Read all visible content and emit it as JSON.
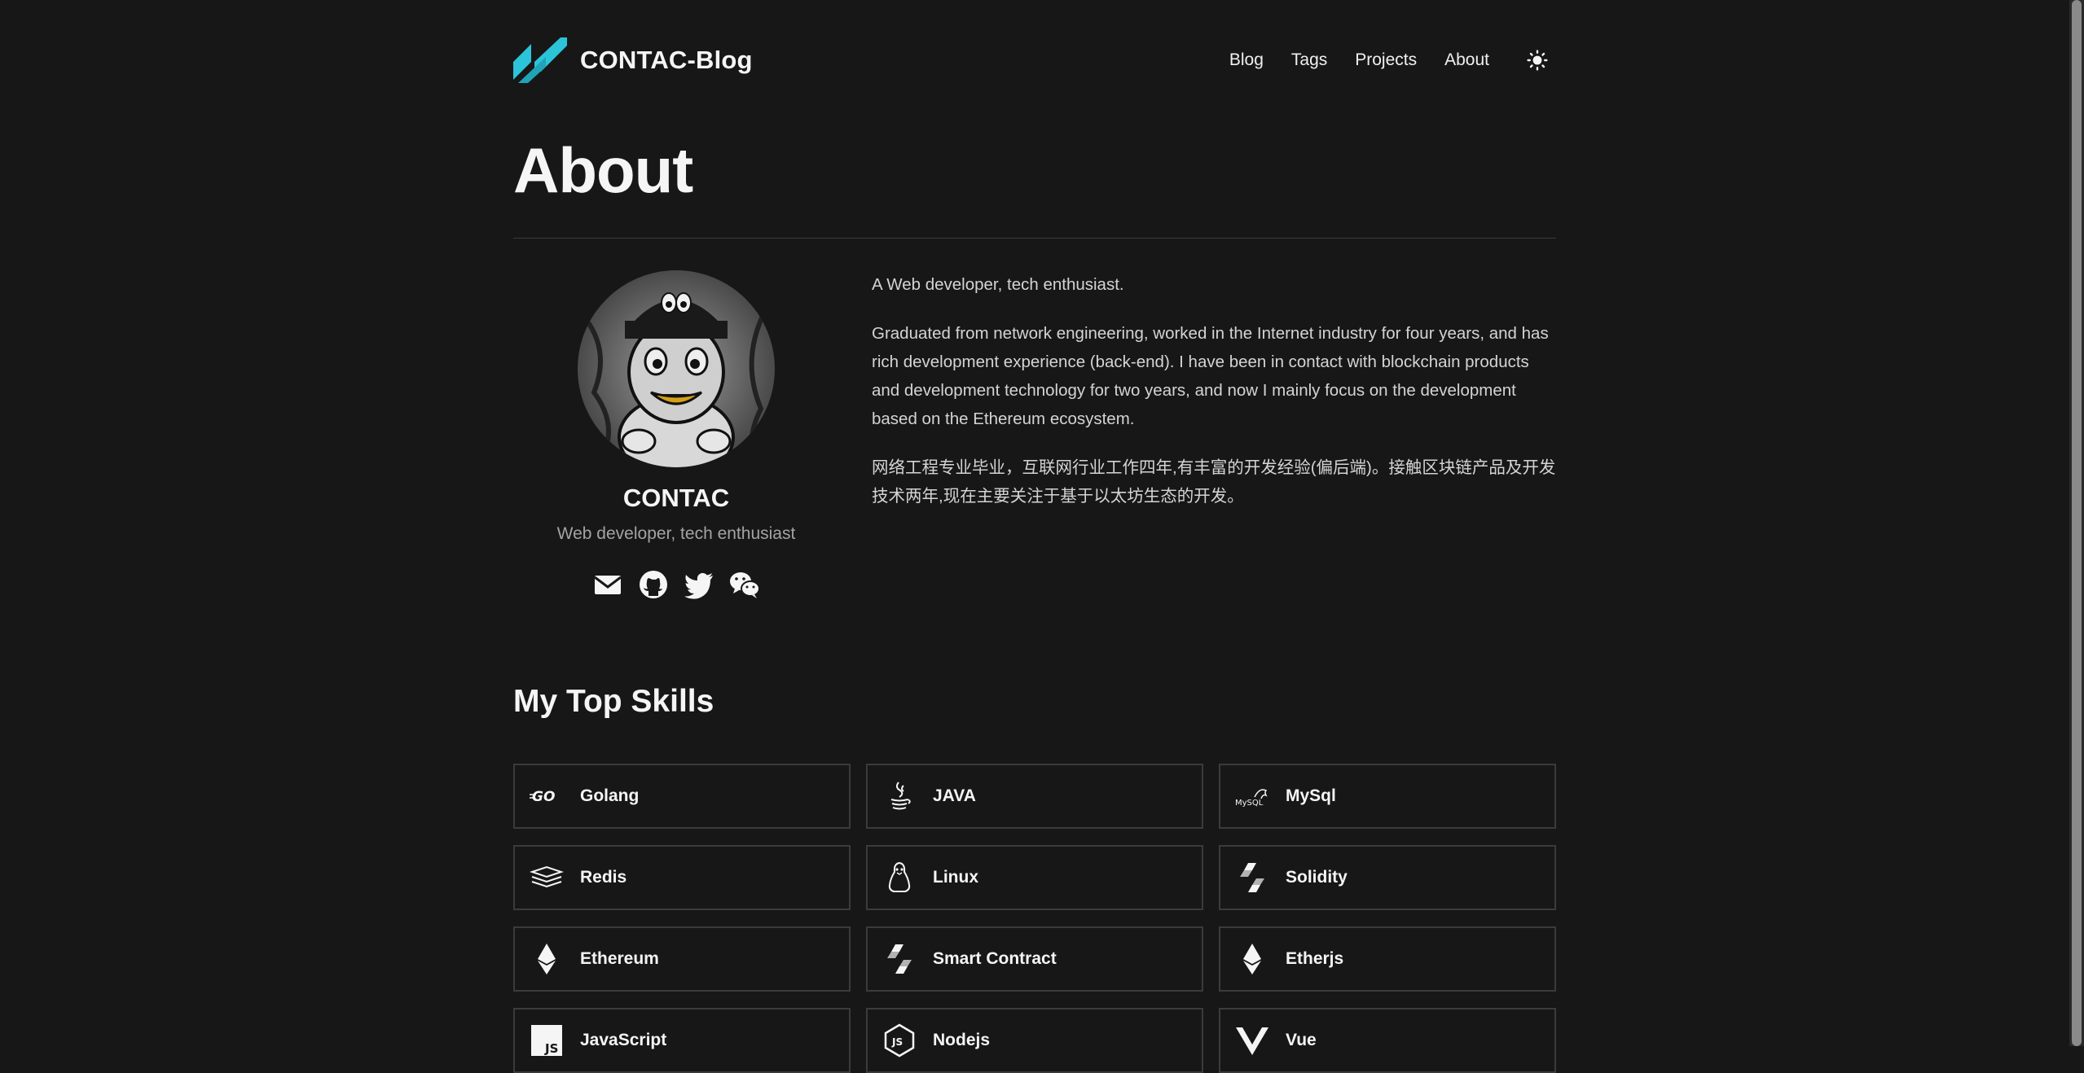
{
  "header": {
    "site_title": "CONTAC-Blog",
    "nav": [
      "Blog",
      "Tags",
      "Projects",
      "About"
    ],
    "theme_icon": "sun-icon",
    "accent_color": "#2cc4d9"
  },
  "page": {
    "title": "About"
  },
  "profile": {
    "name": "CONTAC",
    "tagline": "Web developer, tech enthusiast",
    "socials": [
      "mail-icon",
      "github-icon",
      "twitter-icon",
      "wechat-icon"
    ]
  },
  "bio": {
    "p1": "A Web developer, tech enthusiast.",
    "p2": "Graduated from network engineering, worked in the Internet industry for four years, and has rich development experience (back-end). I have been in contact with blockchain products and development technology for two years, and now I mainly focus on the development based on the Ethereum ecosystem.",
    "p3": "网络工程专业毕业，互联网行业工作四年,有丰富的开发经验(偏后端)。接触区块链产品及开发技术两年,现在主要关注于基于以太坊生态的开发。"
  },
  "skills": {
    "title": "My Top Skills",
    "items": [
      {
        "label": "Golang",
        "icon": "go-icon"
      },
      {
        "label": "JAVA",
        "icon": "java-icon"
      },
      {
        "label": "MySql",
        "icon": "mysql-icon"
      },
      {
        "label": "Redis",
        "icon": "redis-icon"
      },
      {
        "label": "Linux",
        "icon": "linux-icon"
      },
      {
        "label": "Solidity",
        "icon": "solidity-icon"
      },
      {
        "label": "Ethereum",
        "icon": "ethereum-icon"
      },
      {
        "label": "Smart Contract",
        "icon": "solidity-icon"
      },
      {
        "label": "Etherjs",
        "icon": "ethereum-icon"
      },
      {
        "label": "JavaScript",
        "icon": "javascript-icon"
      },
      {
        "label": "Nodejs",
        "icon": "nodejs-icon"
      },
      {
        "label": "Vue",
        "icon": "vue-icon"
      }
    ]
  }
}
